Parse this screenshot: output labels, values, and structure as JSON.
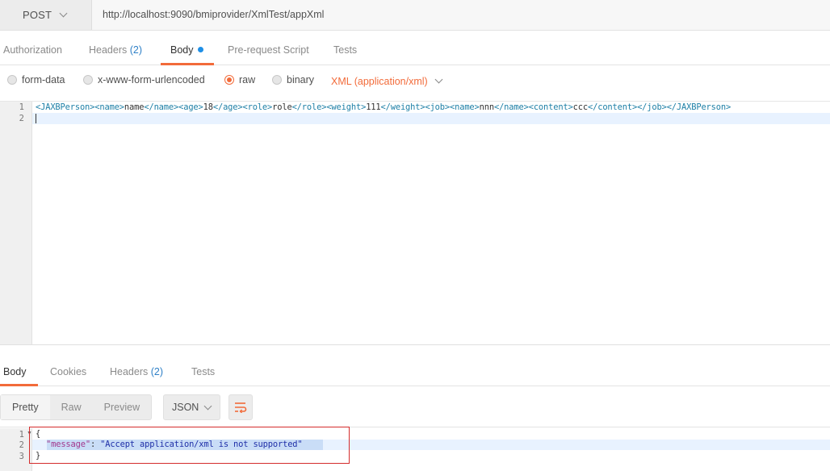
{
  "request": {
    "method": "POST",
    "url": "http://localhost:9090/bmiprovider/XmlTest/appXml"
  },
  "request_tabs": {
    "authorization": "Authorization",
    "headers": "Headers",
    "headers_count": "(2)",
    "body": "Body",
    "prerequest": "Pre-request Script",
    "tests": "Tests"
  },
  "body_types": {
    "form_data": "form-data",
    "urlencoded": "x-www-form-urlencoded",
    "raw": "raw",
    "binary": "binary",
    "selected": "raw",
    "content_type": "XML (application/xml)"
  },
  "editor": {
    "line_numbers": [
      "1",
      "2"
    ],
    "line1_tokens": [
      {
        "t": "<JAXBPerson>",
        "k": "tag"
      },
      {
        "t": "<name>",
        "k": "tag"
      },
      {
        "t": "name",
        "k": "text"
      },
      {
        "t": "</name>",
        "k": "tag"
      },
      {
        "t": "<age>",
        "k": "tag"
      },
      {
        "t": "18",
        "k": "text"
      },
      {
        "t": "</age>",
        "k": "tag"
      },
      {
        "t": "<role>",
        "k": "tag"
      },
      {
        "t": "role",
        "k": "text"
      },
      {
        "t": "</role>",
        "k": "tag"
      },
      {
        "t": "<weight>",
        "k": "tag"
      },
      {
        "t": "111",
        "k": "text"
      },
      {
        "t": "</weight>",
        "k": "tag"
      },
      {
        "t": "<job>",
        "k": "tag"
      },
      {
        "t": "<name>",
        "k": "tag"
      },
      {
        "t": "nnn",
        "k": "text"
      },
      {
        "t": "</name>",
        "k": "tag"
      },
      {
        "t": "<content>",
        "k": "tag"
      },
      {
        "t": "ccc",
        "k": "text"
      },
      {
        "t": "</content>",
        "k": "tag"
      },
      {
        "t": "</job>",
        "k": "tag"
      },
      {
        "t": "</JAXBPerson>",
        "k": "tag"
      }
    ]
  },
  "response_tabs": {
    "body": "Body",
    "cookies": "Cookies",
    "headers": "Headers",
    "headers_count": "(2)",
    "tests": "Tests"
  },
  "response_toolbar": {
    "pretty": "Pretty",
    "raw": "Raw",
    "preview": "Preview",
    "format": "JSON"
  },
  "response": {
    "line_numbers": [
      "1",
      "2",
      "3"
    ],
    "open_brace": "{",
    "key": "\"message\"",
    "colon": ": ",
    "value": "\"Accept application/xml is not supported\"",
    "close_brace": "}"
  },
  "colors": {
    "accent": "#f26b3a",
    "link_blue": "#2f80c7",
    "xml_tag": "#1d7fa6",
    "json_key": "#a2378c",
    "json_string": "#1f2fa8",
    "annotation_box": "#d42c2c"
  }
}
